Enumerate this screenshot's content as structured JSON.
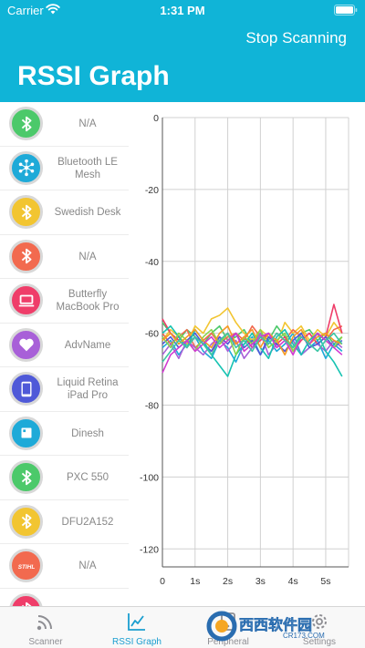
{
  "status_bar": {
    "carrier": "Carrier",
    "time": "1:31 PM"
  },
  "nav": {
    "action": "Stop Scanning",
    "title": "RSSI Graph"
  },
  "devices": [
    {
      "name": "N/A",
      "color": "#4cc96a",
      "icon": "bluetooth-icon"
    },
    {
      "name": "Bluetooth LE Mesh",
      "color": "#1eaad8",
      "icon": "mesh-network-icon"
    },
    {
      "name": "Swedish Desk",
      "color": "#f2c531",
      "icon": "bluetooth-icon"
    },
    {
      "name": "N/A",
      "color": "#f26a4f",
      "icon": "bluetooth-icon"
    },
    {
      "name": "Butterfly MacBook Pro",
      "color": "#ef3d69",
      "icon": "laptop-icon"
    },
    {
      "name": "AdvName",
      "color": "#a860d8",
      "icon": "heart-icon"
    },
    {
      "name": "Liquid Retina iPad Pro",
      "color": "#4f59d8",
      "icon": "tablet-icon"
    },
    {
      "name": "Dinesh",
      "color": "#1eaad8",
      "icon": "square-icon"
    },
    {
      "name": "PXC 550",
      "color": "#4cc96a",
      "icon": "bluetooth-icon"
    },
    {
      "name": "DFU2A152",
      "color": "#f2c531",
      "icon": "bluetooth-icon"
    },
    {
      "name": "N/A",
      "color": "#f26a4f",
      "icon": "stihl-logo-icon",
      "logo_text": "STIHL"
    },
    {
      "name": "",
      "color": "#ef3d69",
      "icon": "bluetooth-icon"
    }
  ],
  "chart_data": {
    "type": "line",
    "xlabel": "",
    "ylabel": "",
    "xlim": [
      0,
      5.7
    ],
    "ylim": [
      -125,
      0
    ],
    "x_ticks": [
      {
        "value": 0,
        "label": "0"
      },
      {
        "value": 1,
        "label": "1s"
      },
      {
        "value": 2,
        "label": "2s"
      },
      {
        "value": 3,
        "label": "3s"
      },
      {
        "value": 4,
        "label": "4s"
      },
      {
        "value": 5,
        "label": "5s"
      }
    ],
    "y_ticks": [
      {
        "value": 0,
        "label": "0"
      },
      {
        "value": -20,
        "label": "-20"
      },
      {
        "value": -40,
        "label": "-40"
      },
      {
        "value": -60,
        "label": "-60"
      },
      {
        "value": -80,
        "label": "-80"
      },
      {
        "value": -100,
        "label": "-100"
      },
      {
        "value": -120,
        "label": "-120"
      }
    ],
    "grid": true,
    "x": [
      0,
      0.25,
      0.5,
      0.75,
      1,
      1.25,
      1.5,
      1.75,
      2,
      2.25,
      2.5,
      2.75,
      3,
      3.25,
      3.5,
      3.75,
      4,
      4.25,
      4.5,
      4.75,
      5,
      5.25,
      5.5
    ],
    "series": [
      {
        "color": "#4cc96a",
        "values": [
          -57,
          -60,
          -62,
          -59,
          -61,
          -63,
          -60,
          -58,
          -62,
          -61,
          -59,
          -63,
          -60,
          -62,
          -58,
          -61,
          -64,
          -60,
          -59,
          -62,
          -60,
          -63,
          -61
        ]
      },
      {
        "color": "#1eaad8",
        "values": [
          -64,
          -62,
          -66,
          -63,
          -61,
          -65,
          -67,
          -62,
          -64,
          -68,
          -63,
          -61,
          -66,
          -62,
          -65,
          -63,
          -60,
          -66,
          -64,
          -62,
          -67,
          -63,
          -65
        ]
      },
      {
        "color": "#f2c531",
        "values": [
          -62,
          -59,
          -61,
          -63,
          -58,
          -60,
          -56,
          -55,
          -53,
          -57,
          -60,
          -62,
          -59,
          -61,
          -63,
          -57,
          -60,
          -58,
          -62,
          -59,
          -61,
          -57,
          -60
        ]
      },
      {
        "color": "#f26a4f",
        "values": [
          -60,
          -63,
          -61,
          -59,
          -64,
          -62,
          -60,
          -63,
          -61,
          -60,
          -62,
          -58,
          -61,
          -63,
          -60,
          -62,
          -59,
          -61,
          -63,
          -60,
          -62,
          -59,
          -58
        ]
      },
      {
        "color": "#ef3d69",
        "values": [
          -56,
          -60,
          -62,
          -64,
          -61,
          -63,
          -65,
          -62,
          -60,
          -63,
          -61,
          -64,
          -62,
          -60,
          -63,
          -61,
          -65,
          -62,
          -60,
          -63,
          -61,
          -52,
          -60
        ]
      },
      {
        "color": "#a860d8",
        "values": [
          -66,
          -63,
          -67,
          -62,
          -64,
          -66,
          -63,
          -61,
          -65,
          -62,
          -67,
          -64,
          -60,
          -66,
          -63,
          -65,
          -62,
          -66,
          -64,
          -63,
          -65,
          -62,
          -64
        ]
      },
      {
        "color": "#4f59d8",
        "values": [
          -63,
          -61,
          -64,
          -62,
          -60,
          -63,
          -65,
          -61,
          -63,
          -60,
          -64,
          -62,
          -66,
          -61,
          -63,
          -65,
          -62,
          -60,
          -64,
          -63,
          -61,
          -64,
          -62
        ]
      },
      {
        "color": "#17c3b2",
        "values": [
          -60,
          -58,
          -61,
          -64,
          -59,
          -62,
          -66,
          -69,
          -72,
          -66,
          -63,
          -60,
          -64,
          -67,
          -61,
          -59,
          -63,
          -66,
          -62,
          -60,
          -65,
          -68,
          -72
        ]
      },
      {
        "color": "#8bd44a",
        "values": [
          -61,
          -64,
          -60,
          -62,
          -65,
          -61,
          -59,
          -63,
          -60,
          -66,
          -61,
          -63,
          -59,
          -64,
          -62,
          -60,
          -65,
          -61,
          -63,
          -60,
          -62,
          -64,
          -61
        ]
      },
      {
        "color": "#f59a23",
        "values": [
          -62,
          -60,
          -63,
          -61,
          -59,
          -62,
          -64,
          -60,
          -58,
          -63,
          -61,
          -59,
          -64,
          -60,
          -62,
          -66,
          -61,
          -59,
          -63,
          -61,
          -60,
          -62,
          -63
        ]
      },
      {
        "color": "#d13ad1",
        "values": [
          -71,
          -66,
          -64,
          -62,
          -65,
          -63,
          -61,
          -64,
          -62,
          -60,
          -65,
          -63,
          -61,
          -60,
          -64,
          -62,
          -66,
          -61,
          -63,
          -60,
          -62,
          -64,
          -66
        ]
      },
      {
        "color": "#3ec6a5",
        "values": [
          -68,
          -65,
          -62,
          -64,
          -61,
          -63,
          -66,
          -62,
          -60,
          -64,
          -62,
          -65,
          -61,
          -63,
          -60,
          -62,
          -64,
          -61,
          -63,
          -65,
          -62,
          -60,
          -63
        ]
      }
    ]
  },
  "tabs": [
    {
      "label": "Scanner",
      "icon": "scanner-icon",
      "active": false
    },
    {
      "label": "RSSI Graph",
      "icon": "graph-icon",
      "active": true
    },
    {
      "label": "Peripheral",
      "icon": "peripheral-icon",
      "active": false
    },
    {
      "label": "Settings",
      "icon": "gear-icon",
      "active": false
    }
  ],
  "watermark": {
    "text": "西西软件园",
    "sub": "CR173.COM"
  },
  "colors": {
    "header": "#10b4d7",
    "tab_active": "#1a9ed0",
    "tab_inactive": "#8e8e93",
    "grid": "#d0d0d0"
  }
}
